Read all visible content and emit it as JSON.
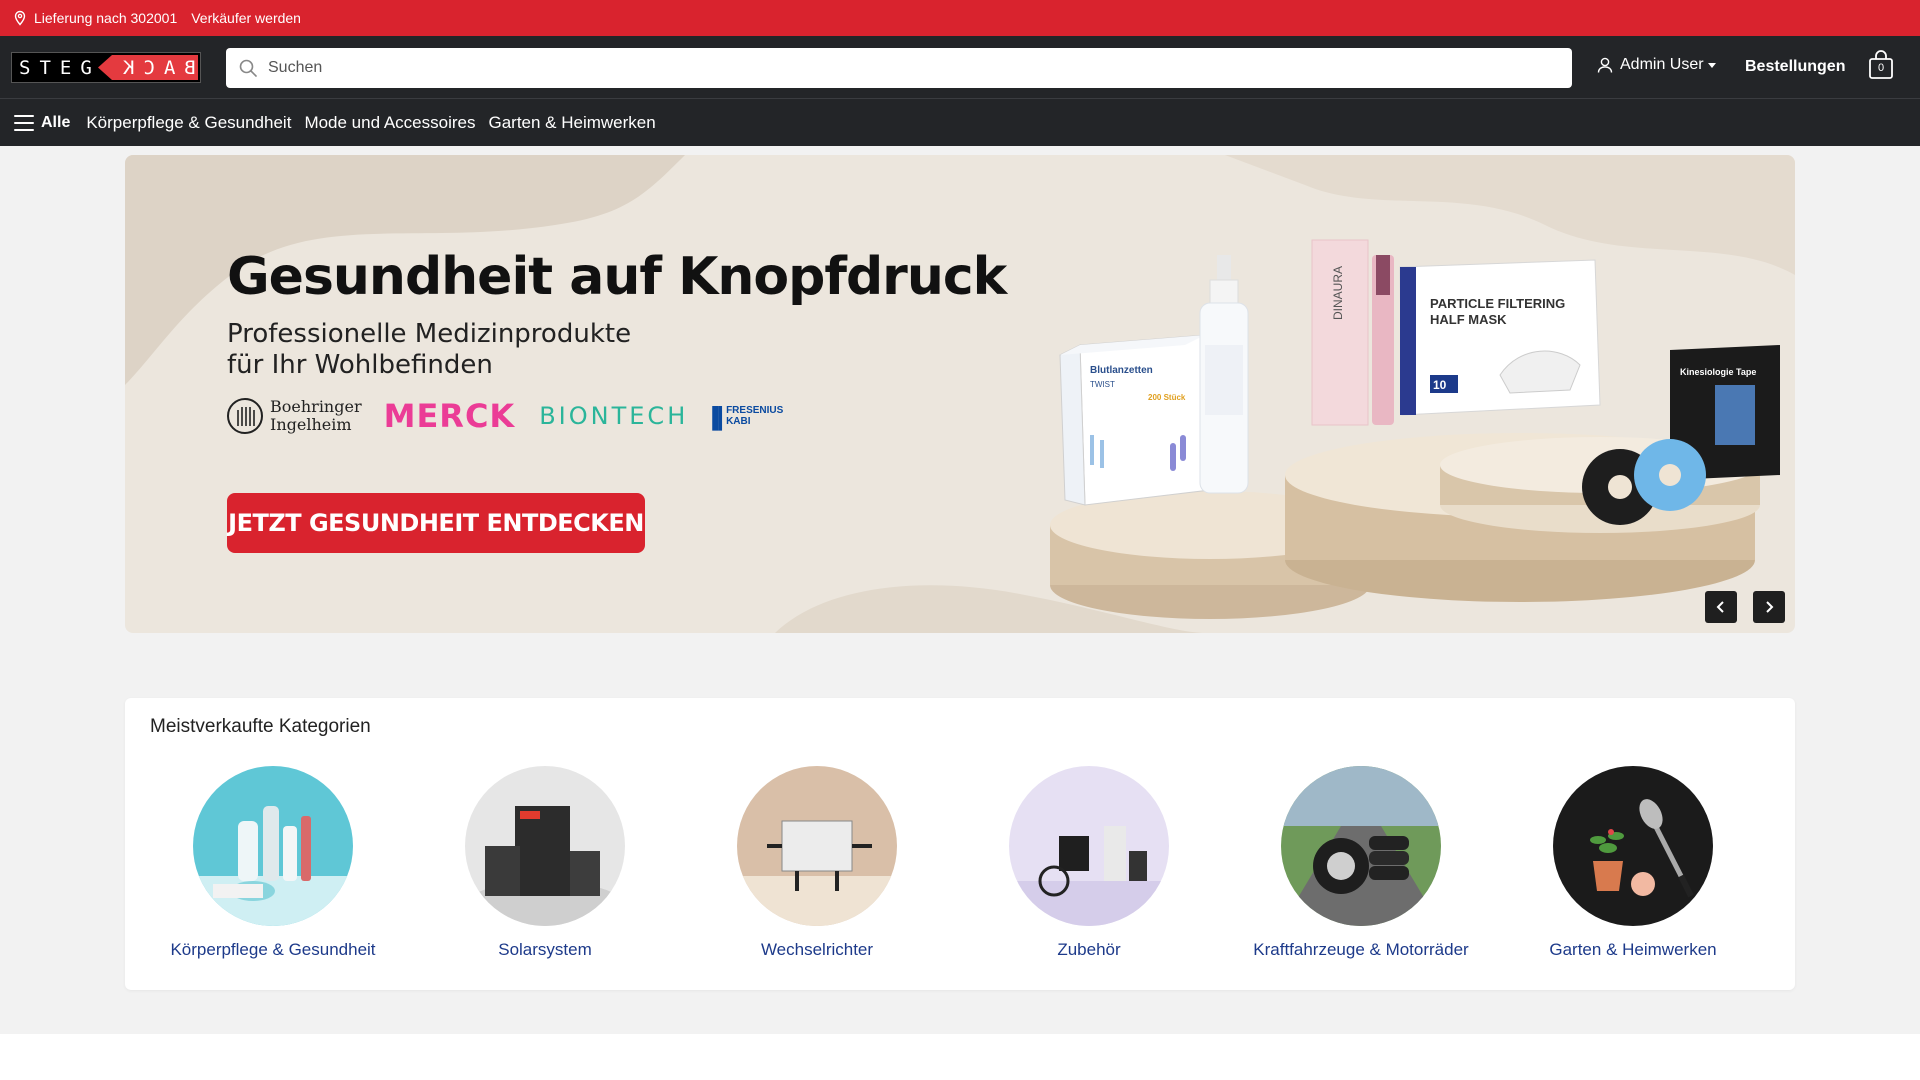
{
  "topbar": {
    "delivery": "Lieferung nach 302001",
    "become_seller": "Verkäufer werden"
  },
  "header": {
    "logo_left": "STEG",
    "logo_right": "BACK",
    "search_placeholder": "Suchen",
    "user_label": "Admin User",
    "orders_label": "Bestellungen",
    "cart_count": "0"
  },
  "nav": {
    "all_label": "Alle",
    "items": [
      {
        "label": "Körperpflege & Gesundheit"
      },
      {
        "label": "Mode und Accessoires"
      },
      {
        "label": "Garten & Heimwerken"
      }
    ]
  },
  "hero": {
    "title": "Gesundheit auf Knopfdruck",
    "subtitle_line1": "Professionelle Medizinprodukte",
    "subtitle_line2": "für Ihr Wohlbefinden",
    "brands": {
      "bi_line1": "Boehringer",
      "bi_line2": "Ingelheim",
      "merck": "MERCK",
      "biontech": "BIONTECH",
      "fresenius_line1": "FRESENIUS",
      "fresenius_line2": "KABI"
    },
    "cta": "JETZT GESUNDHEIT ENTDECKEN",
    "product_texts": {
      "box1_title": "Blutlanzetten",
      "box1_sub": "TWIST",
      "box1_count": "200 Stück",
      "dinaura": "DINAURA",
      "mask_line1": "PARTICLE FILTERING",
      "mask_line2": "HALF MASK",
      "mask_count": "10",
      "tape": "Kinesiologie Tape"
    }
  },
  "categories": {
    "title": "Meistverkaufte Kategorien",
    "items": [
      {
        "label": "Körperpflege & Gesundheit"
      },
      {
        "label": "Solarsystem"
      },
      {
        "label": "Wechselrichter"
      },
      {
        "label": "Zubehör"
      },
      {
        "label": "Kraftfahrzeuge & Motorräder"
      },
      {
        "label": "Garten & Heimwerken"
      }
    ]
  },
  "colors": {
    "brand_red": "#d9232e",
    "header_dark": "#232528",
    "link_blue": "#1d3a8a"
  }
}
